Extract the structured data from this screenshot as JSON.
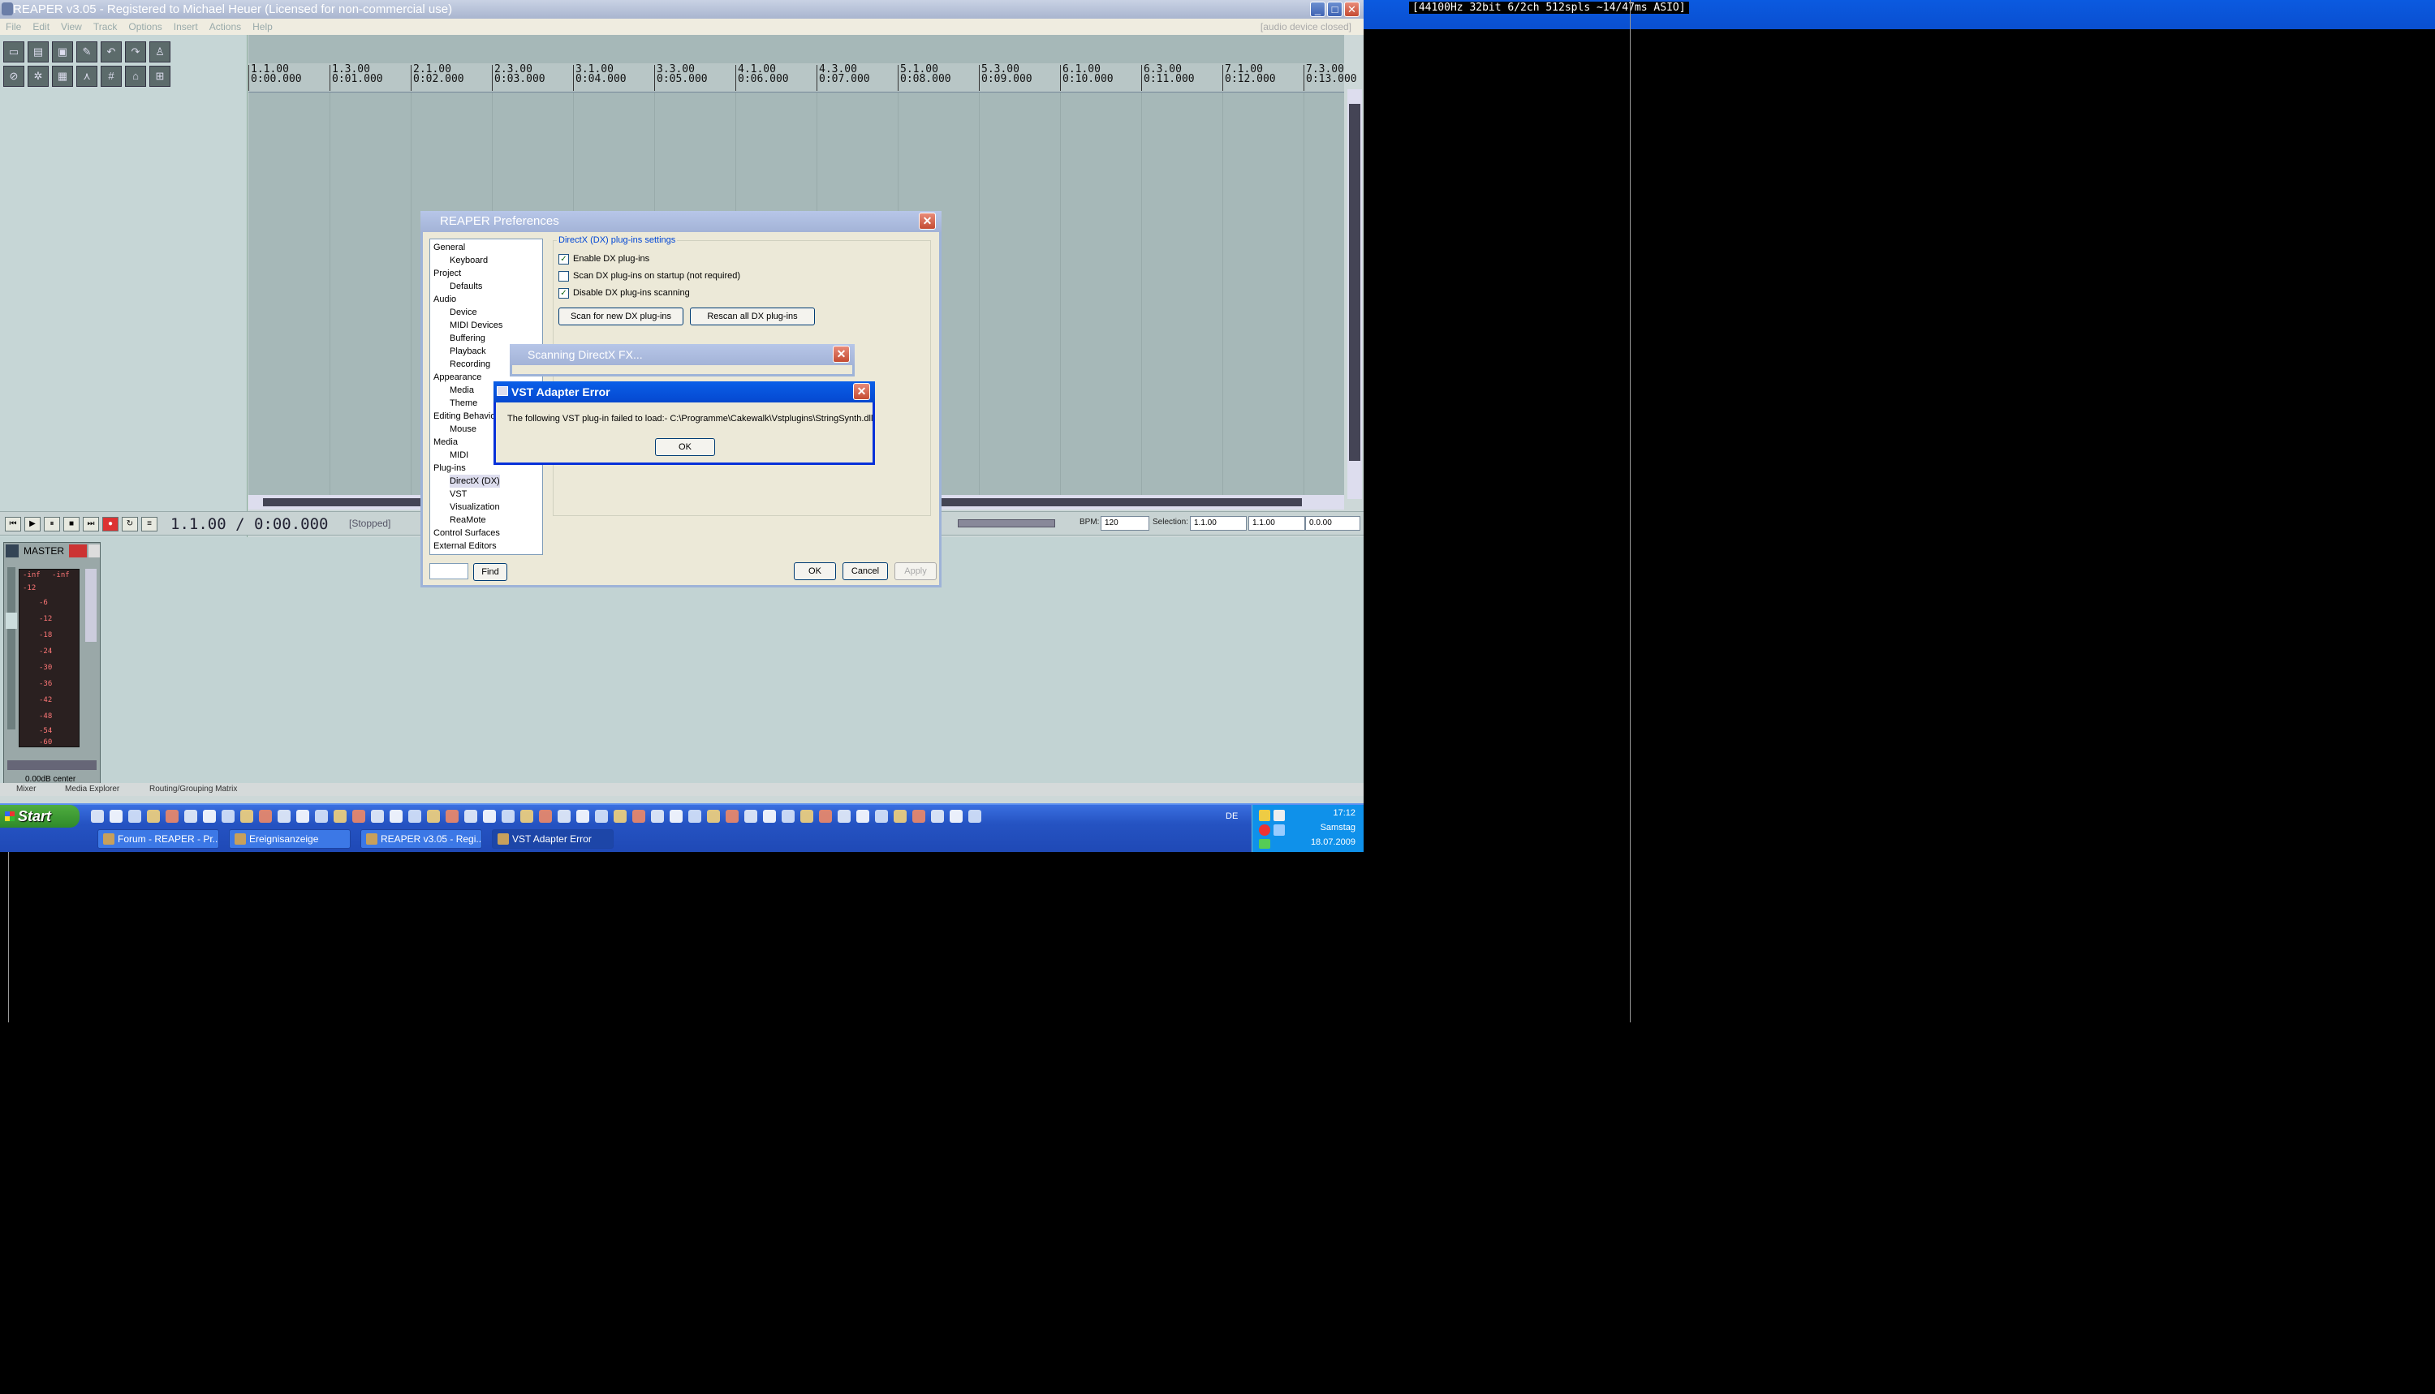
{
  "window": {
    "title": "REAPER v3.05 - Registered to Michael Heuer (Licensed for non-commercial use)",
    "menu": [
      "File",
      "Edit",
      "View",
      "Track",
      "Options",
      "Insert",
      "Actions",
      "Help"
    ],
    "menu_status": "[audio device closed]"
  },
  "top_status": "[44100Hz 32bit 6/2ch 512spls ~14/47ms ASIO]",
  "ruler": [
    {
      "bar": "1.1.00",
      "time": "0:00.000"
    },
    {
      "bar": "1.3.00",
      "time": "0:01.000"
    },
    {
      "bar": "2.1.00",
      "time": "0:02.000"
    },
    {
      "bar": "2.3.00",
      "time": "0:03.000"
    },
    {
      "bar": "3.1.00",
      "time": "0:04.000"
    },
    {
      "bar": "3.3.00",
      "time": "0:05.000"
    },
    {
      "bar": "4.1.00",
      "time": "0:06.000"
    },
    {
      "bar": "4.3.00",
      "time": "0:07.000"
    },
    {
      "bar": "5.1.00",
      "time": "0:08.000"
    },
    {
      "bar": "5.3.00",
      "time": "0:09.000"
    },
    {
      "bar": "6.1.00",
      "time": "0:10.000"
    },
    {
      "bar": "6.3.00",
      "time": "0:11.000"
    },
    {
      "bar": "7.1.00",
      "time": "0:12.000"
    },
    {
      "bar": "7.3.00",
      "time": "0:13.000"
    }
  ],
  "transport": {
    "position": "1.1.00 / 0:00.000",
    "state": "[Stopped]",
    "bpm_label": "BPM:",
    "bpm": "120",
    "selection_label": "Selection:",
    "sel_start": "1.1.00",
    "sel_end": "1.1.00",
    "sel_len": "0.0.00"
  },
  "mixer": {
    "master_label": "MASTER",
    "peak_left": "-inf",
    "peak_right": "-inf",
    "scale": [
      "-12",
      "-6",
      "-12",
      "-18",
      "-24",
      "-30",
      "-36",
      "-42",
      "-48",
      "-54",
      "-60"
    ],
    "pan_text": "0.00dB center",
    "tabs": [
      "Mixer",
      "Media Explorer",
      "Routing/Grouping Matrix"
    ]
  },
  "prefs": {
    "title": "REAPER Preferences",
    "tree": [
      {
        "label": "General",
        "indent": 0
      },
      {
        "label": "Keyboard",
        "indent": 1
      },
      {
        "label": "Project",
        "indent": 0
      },
      {
        "label": "Defaults",
        "indent": 1
      },
      {
        "label": "Audio",
        "indent": 0
      },
      {
        "label": "Device",
        "indent": 1
      },
      {
        "label": "MIDI Devices",
        "indent": 1
      },
      {
        "label": "Buffering",
        "indent": 1
      },
      {
        "label": "Playback",
        "indent": 1
      },
      {
        "label": "Recording",
        "indent": 1
      },
      {
        "label": "Appearance",
        "indent": 0
      },
      {
        "label": "Media",
        "indent": 1
      },
      {
        "label": "Theme",
        "indent": 1
      },
      {
        "label": "Editing Behavio",
        "indent": 0
      },
      {
        "label": "Mouse",
        "indent": 1
      },
      {
        "label": "Media",
        "indent": 0
      },
      {
        "label": "MIDI",
        "indent": 1
      },
      {
        "label": "Plug-ins",
        "indent": 0
      },
      {
        "label": "DirectX (DX)",
        "indent": 1,
        "selected": true
      },
      {
        "label": "VST",
        "indent": 1
      },
      {
        "label": "Visualization",
        "indent": 1
      },
      {
        "label": "ReaMote",
        "indent": 1
      },
      {
        "label": "Control Surfaces",
        "indent": 0
      },
      {
        "label": "External Editors",
        "indent": 0
      }
    ],
    "section_title": "DirectX (DX) plug-ins settings",
    "enable_dx": "Enable DX plug-ins",
    "scan_startup": "Scan DX plug-ins on startup (not required)",
    "disable_scan": "Disable DX plug-ins scanning",
    "scan_new": "Scan for new DX plug-ins",
    "rescan_all": "Rescan all DX plug-ins",
    "find": "Find",
    "ok": "OK",
    "cancel": "Cancel",
    "apply": "Apply"
  },
  "scanning": {
    "title": "Scanning DirectX FX..."
  },
  "error": {
    "title": "VST Adapter Error",
    "message": "The following VST plug-in failed to load:- C:\\Programme\\Cakewalk\\Vstplugins\\StringSynth.dll",
    "ok": "OK"
  },
  "taskbar": {
    "start": "Start",
    "tasks": [
      "Forum - REAPER - Pr...",
      "Ereignisanzeige",
      "REAPER v3.05 - Regi...",
      "VST Adapter Error"
    ],
    "lang": "DE",
    "time": "17:12",
    "day": "Samstag",
    "date": "18.07.2009"
  }
}
